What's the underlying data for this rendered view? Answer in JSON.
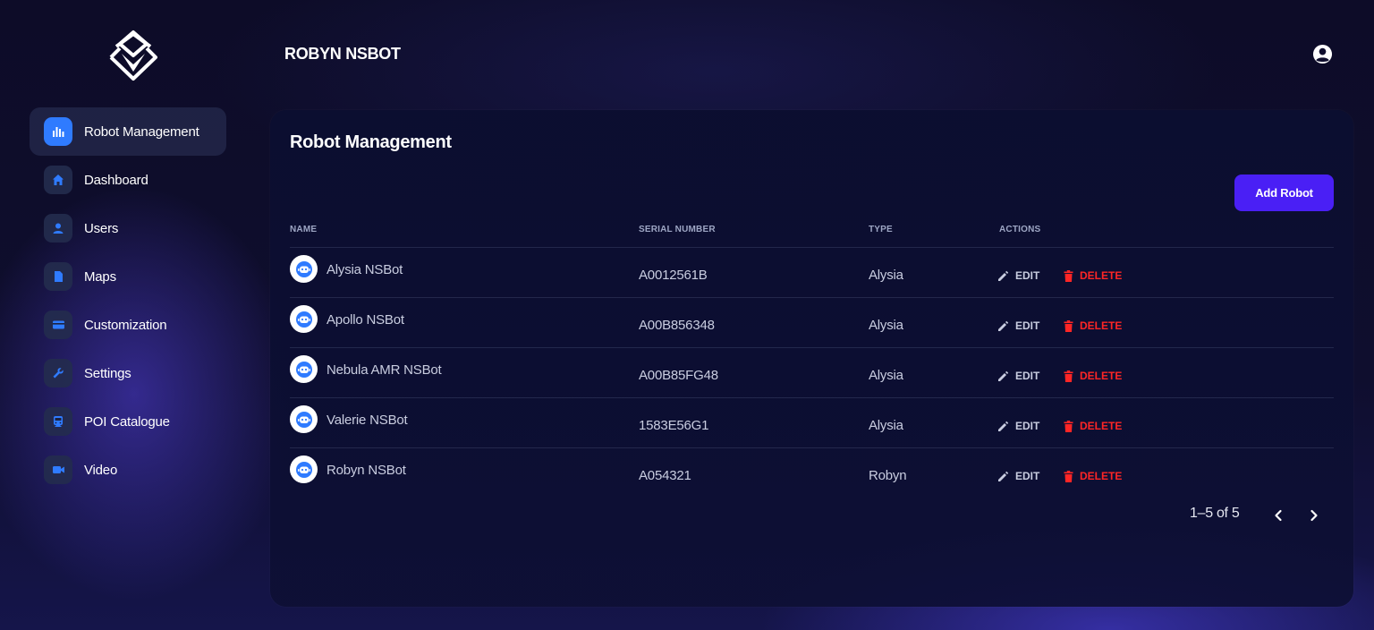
{
  "app_title": "ROBYN NSBOT",
  "brand_color": "#2f7bff",
  "accent_button_color": "#4a1ff5",
  "delete_color": "#ff2525",
  "sidebar": {
    "items": [
      {
        "label": "Robot Management",
        "icon": "bar-chart-icon",
        "active": true
      },
      {
        "label": "Dashboard",
        "icon": "home-icon"
      },
      {
        "label": "Users",
        "icon": "user-icon"
      },
      {
        "label": "Maps",
        "icon": "document-icon"
      },
      {
        "label": "Customization",
        "icon": "card-icon"
      },
      {
        "label": "Settings",
        "icon": "wrench-icon"
      },
      {
        "label": "POI Catalogue",
        "icon": "tram-icon"
      },
      {
        "label": "Video",
        "icon": "video-camera-icon"
      }
    ]
  },
  "main": {
    "title": "Robot Management",
    "add_button_label": "Add Robot",
    "columns": {
      "name": "NAME",
      "serial": "SERIAL NUMBER",
      "type": "TYPE",
      "actions": "ACTIONS"
    },
    "rows": [
      {
        "name": "Alysia NSBot",
        "serial": "A0012561B",
        "type": "Alysia"
      },
      {
        "name": "Apollo NSBot",
        "serial": "A00B856348",
        "type": "Alysia"
      },
      {
        "name": "Nebula AMR NSBot",
        "serial": "A00B85FG48",
        "type": "Alysia"
      },
      {
        "name": "Valerie NSBot",
        "serial": "1583E56G1",
        "type": "Alysia"
      },
      {
        "name": "Robyn NSBot",
        "serial": "A054321",
        "type": "Robyn"
      }
    ],
    "edit_label": "EDIT",
    "delete_label": "DELETE",
    "pagination": "1–5 of 5"
  }
}
